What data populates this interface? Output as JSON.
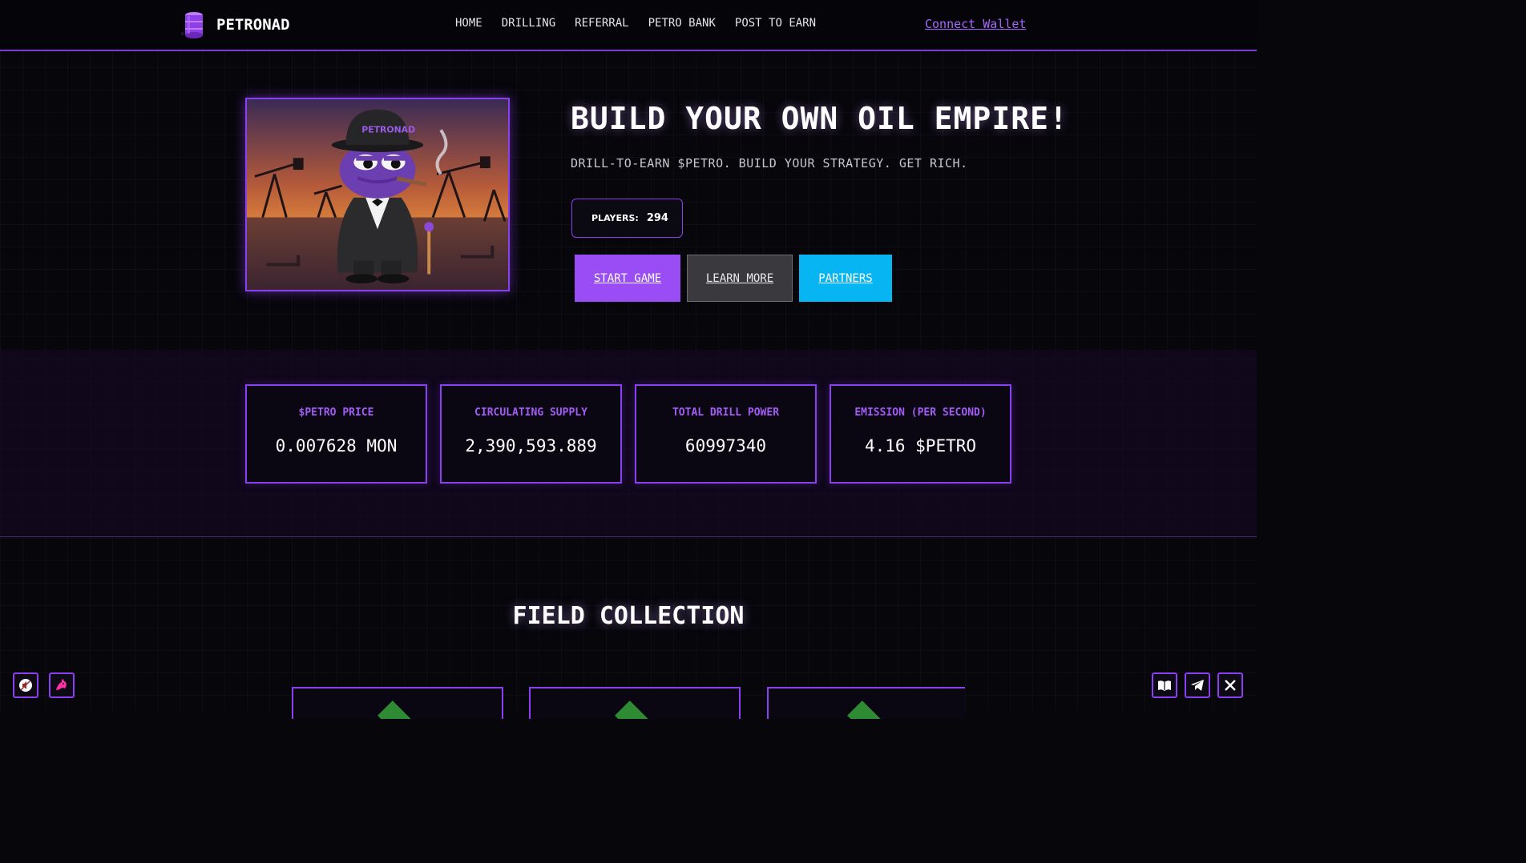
{
  "header": {
    "brand": "PETRONAD",
    "nav": [
      "HOME",
      "DRILLING",
      "REFERRAL",
      "PETRO BANK",
      "POST TO EARN"
    ],
    "connect_label": "Connect Wallet"
  },
  "hero": {
    "image_text": "PETRONAD",
    "title": "BUILD YOUR OWN OIL EMPIRE!",
    "subtitle": "DRILL-TO-EARN $PETRO. BUILD YOUR STRATEGY. GET RICH.",
    "players_label": "PLAYERS:",
    "players_value": "294",
    "buttons": {
      "start": "START GAME",
      "learn": "LEARN MORE",
      "partners": "PARTNERS"
    }
  },
  "stats": [
    {
      "title": "$PETRO PRICE",
      "value": "0.007628 MON"
    },
    {
      "title": "CIRCULATING SUPPLY",
      "value": "2,390,593.889"
    },
    {
      "title": "TOTAL DRILL POWER",
      "value": "60997340"
    },
    {
      "title": "EMISSION (PER SECOND)",
      "value": "4.16 $PETRO"
    }
  ],
  "field_collection": {
    "title": "FIELD COLLECTION"
  },
  "floating_left": [
    "mute-icon",
    "unicorn-icon"
  ],
  "floating_right": [
    "book-icon",
    "telegram-icon",
    "x-icon"
  ],
  "colors": {
    "accent": "#8a3ff0",
    "start_button": "#9b4df5",
    "partners_button": "#07b5f2",
    "stat_title": "#a45cf6"
  }
}
